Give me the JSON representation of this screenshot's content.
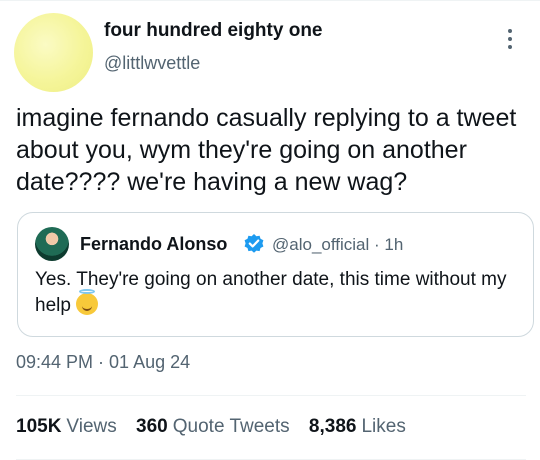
{
  "author": {
    "display_name": "four hundred eighty one",
    "handle": "@littlwvettle"
  },
  "tweet": {
    "text": "imagine fernando casually replying to a tweet about you, wym they're going on another date???? we're having a new wag?"
  },
  "quoted_tweet": {
    "display_name": "Fernando Alonso",
    "handle": "@alo_official",
    "time_ago": "· 1h",
    "text": "Yes. They're going on another date, this time without my help",
    "emoji_icon": "smiling-face-with-halo-icon",
    "verified_color": "#1d9bf0"
  },
  "timestamp": "09:44 PM · 01 Aug 24",
  "stats": {
    "views_count": "105K",
    "views_label": "Views",
    "quotes_count": "360",
    "quotes_label": "Quote Tweets",
    "likes_count": "8,386",
    "likes_label": "Likes"
  }
}
